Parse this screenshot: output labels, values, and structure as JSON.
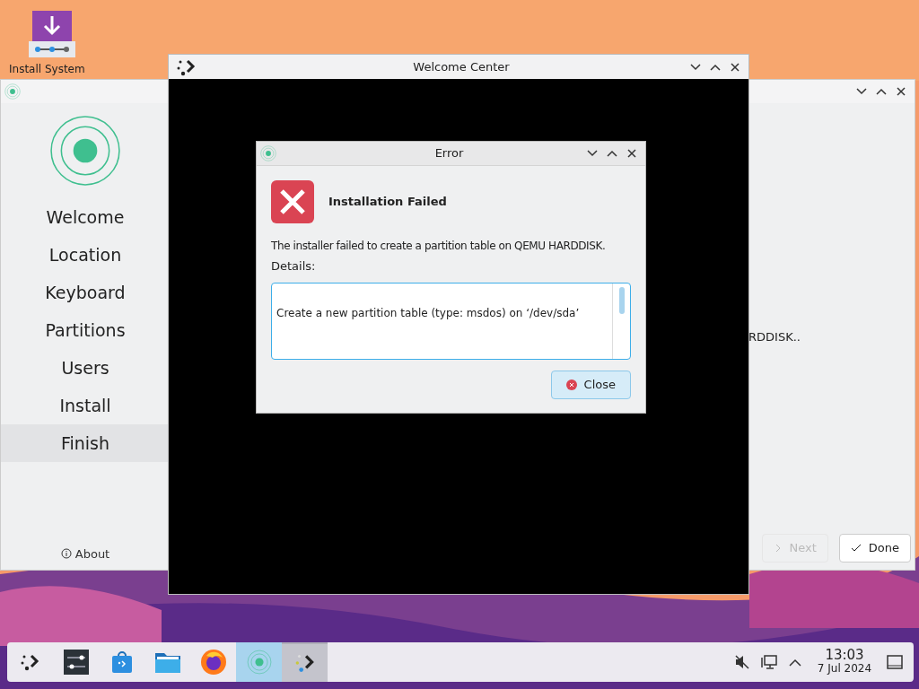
{
  "desktop_icons": [
    {
      "label": "Install System"
    }
  ],
  "installer": {
    "steps": [
      {
        "label": "Welcome",
        "selected": false
      },
      {
        "label": "Location",
        "selected": false
      },
      {
        "label": "Keyboard",
        "selected": false
      },
      {
        "label": "Partitions",
        "selected": false
      },
      {
        "label": "Users",
        "selected": false
      },
      {
        "label": "Install",
        "selected": false
      },
      {
        "label": "Finish",
        "selected": true
      }
    ],
    "about": "About",
    "status_text": "RDDISK..",
    "buttons": [
      {
        "label": "Next",
        "kind": "next",
        "disabled": true
      },
      {
        "label": "Done",
        "kind": "done",
        "disabled": false
      }
    ]
  },
  "welcome_center": {
    "title": "Welcome Center"
  },
  "error_dialog": {
    "title": "Error",
    "heading": "Installation Failed",
    "message": "The installer failed to create a partition table on QEMU HARDDISK.",
    "details_label": "Details:",
    "details": [
      "Create a new partition table (type: msdos) on ‘/dev/sda’"
    ],
    "button": "Close"
  },
  "taskbar": {
    "apps": [
      {
        "kind": "launcher",
        "selected": false,
        "hovered": false
      },
      {
        "kind": "settings",
        "selected": false,
        "hovered": false
      },
      {
        "kind": "store",
        "selected": false,
        "hovered": false
      },
      {
        "kind": "files",
        "selected": false,
        "hovered": false
      },
      {
        "kind": "browser",
        "selected": false,
        "hovered": false
      },
      {
        "kind": "installer",
        "selected": true,
        "hovered": false
      },
      {
        "kind": "welcome",
        "selected": false,
        "hovered": true
      }
    ],
    "time": "13:03",
    "date": "7 Jul 2024"
  }
}
